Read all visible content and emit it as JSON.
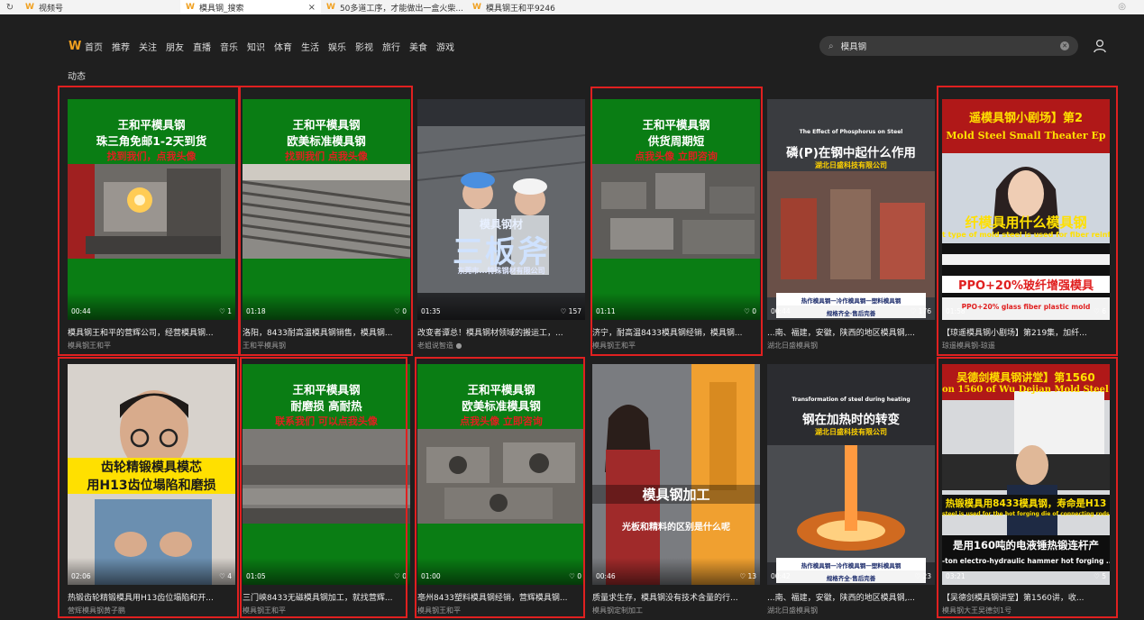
{
  "tabs": [
    {
      "label": "视频号"
    },
    {
      "label": "模具钢_搜索",
      "close": "×"
    },
    {
      "label": "50多道工序，才能做出一盒火柴..."
    },
    {
      "label": "模具钢王和平9246"
    }
  ],
  "nav": {
    "items": [
      "首页",
      "推荐",
      "关注",
      "朋友",
      "直播",
      "音乐",
      "知识",
      "体育",
      "生活",
      "娱乐",
      "影视",
      "旅行",
      "美食",
      "游戏"
    ]
  },
  "search": {
    "query": "模具钢"
  },
  "section_title": "动态",
  "cards": [
    {
      "duration": "00:44",
      "likes": "♡ 1",
      "title": "模具钢王和平的营辉公司，经营模具钢...",
      "author": "模具钢王和平",
      "promo": [
        "王和平模具钢",
        "珠三角免邮1-2天到货",
        "找到我们，点我头像"
      ]
    },
    {
      "duration": "01:18",
      "likes": "♡ 0",
      "title": "洛阳，8433耐高温模具钢销售，模具钢...",
      "author": "王和平模具钢",
      "promo": [
        "王和平模具钢",
        "欧美标准模具钢",
        "找到我们 点我头像"
      ]
    },
    {
      "duration": "01:35",
      "likes": "♡ 157",
      "title": "改变者谭总！模具钢材领域的搬运工，...",
      "author": "老姐说智造 ●",
      "caption": "三板斧",
      "sub": "模具钢材",
      "company": "东莞市...特殊钢材有限公司"
    },
    {
      "duration": "01:11",
      "likes": "♡ 0",
      "title": "济宁，耐高温8433模具钢经销，模具钢...",
      "author": "模具钢王和平",
      "promo": [
        "王和平模具钢",
        "供货周期短",
        "点我头像 立即咨询"
      ]
    },
    {
      "duration": "00:44",
      "likes": "♡ 176",
      "title": "...南、福建，安徽，陕西的地区模具钢,...",
      "author": "湖北日盛模具钢",
      "en": "The Effect of Phosphorus on Steel",
      "cap": "磷(P)在钢中起什么作用",
      "company": "湖北日盛科技有限公司",
      "strip1": "热作模具钢一冷作模具钢一塑料模具钢",
      "strip2": "规格齐全·售后完善"
    },
    {
      "duration": "01:58",
      "likes": "♡ 6",
      "title": "【琼遥模具钢小剧场】第219集，加纤...",
      "author": "琼遥模具钢-琼遥",
      "top_cn": "遥模具钢小剧场】第2",
      "top_en": "Mold Steel Small Theater Ep",
      "mid_cn": "纤模具用什么模具钢",
      "mid_en": "t type of mold steel is used for fiber reinforc",
      "bot_cn": "PPO+20%玻纤增强模具",
      "bot_en": "PPO+20% glass fiber plastic mold"
    },
    {
      "duration": "02:06",
      "likes": "♡ 4",
      "title": "热锻齿轮精锻模具用H13齿位塌陷和开...",
      "author": "营辉模具钢黄子鹏",
      "cap1": "齿轮精锻模具模芯",
      "cap2": "用H13齿位塌陷和磨损"
    },
    {
      "duration": "01:05",
      "likes": "♡ 0",
      "title": "三门峡8433无磁模具钢加工，就找营辉...",
      "author": "模具钢王和平",
      "promo": [
        "王和平模具钢",
        "耐磨损 高耐热",
        "联系我们 可以点我头像"
      ]
    },
    {
      "duration": "01:00",
      "likes": "♡ 0",
      "title": "亳州8433塑料模具钢经销，营辉模具钢...",
      "author": "模具钢王和平",
      "promo": [
        "王和平模具钢",
        "欧美标准模具钢",
        "点我头像 立即咨询"
      ]
    },
    {
      "duration": "00:46",
      "likes": "♡ 13",
      "title": "质量求生存，模具钢没有技术含量的行...",
      "author": "模具钢定制加工",
      "cap": "模具钢加工",
      "sub": "光板和精料的区别是什么呢"
    },
    {
      "duration": "00:42",
      "likes": "♡ 23",
      "title": "...南、福建，安徽，陕西的地区模具钢,...",
      "author": "湖北日盛模具钢",
      "en": "Transformation of steel during heating",
      "cap": "钢在加热时的转变",
      "company": "湖北日盛科技有限公司",
      "strip1": "热作模具钢一冷作模具钢一塑料模具钢",
      "strip2": "规格齐全·售后完善"
    },
    {
      "duration": "03:21",
      "likes": "♡ 5",
      "title": "【吴德剑模具钢讲堂】第1560讲，收...",
      "author": "模具钢大王吴德剑1号",
      "top_cn": "吴德剑模具钢讲堂】第1560",
      "top_en": "on 1560 of Wu Dejian Mold Steel Lectu",
      "mid_cn": "热锻模具用8433模具钢，寿命是H13",
      "mid_en": "steel is used for the hot forging die of connecting rods...",
      "bot_cn": "是用160吨的电液锤热锻连杆产",
      "bot_en": "-ton electro-hydraulic hammer hot forging ... rod product."
    }
  ],
  "colors": {
    "accent": "#f0a020",
    "highlight_border": "#e02020",
    "promo_green": "#0a7d14"
  }
}
